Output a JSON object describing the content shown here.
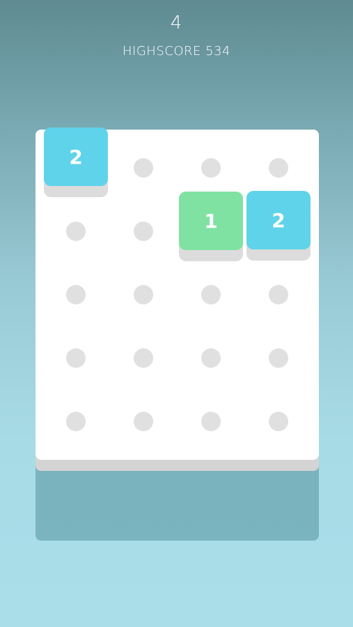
{
  "header": {
    "score": "4",
    "highscore_label": "HIGHSCORE 534"
  },
  "colors": {
    "tile_two": "#5fd3e9",
    "tile_one": "#7fe2a3",
    "empty_slot": "#e0e0e0"
  },
  "tiles": [
    {
      "value": "2",
      "row": 1,
      "col": 1,
      "color": "#5fd3e9"
    },
    {
      "value": "1",
      "row": 2,
      "col": 3,
      "color": "#7fe2a3"
    },
    {
      "value": "2",
      "row": 2,
      "col": 4,
      "color": "#5fd3e9"
    }
  ],
  "board": {
    "rows": 5,
    "cols": 4
  }
}
